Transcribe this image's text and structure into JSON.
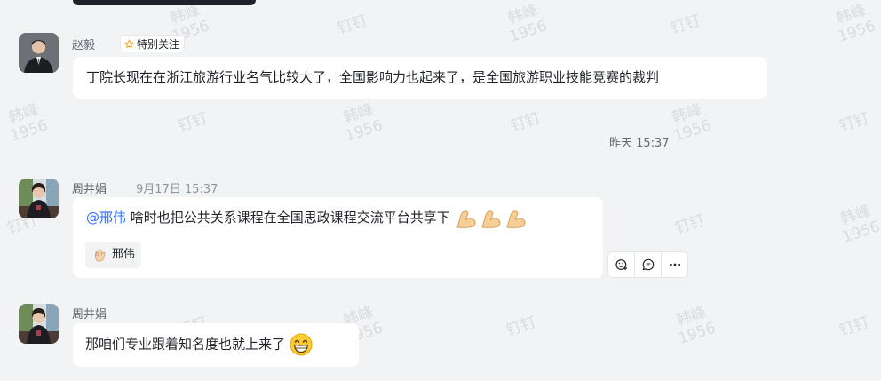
{
  "watermark": {
    "line1": "韩峰",
    "line2": "1956",
    "alt": "钉钉"
  },
  "messages": [
    {
      "sender": "赵毅",
      "tag_label": "特别关注",
      "text": "丁院长现在在浙江旅游行业名气比较大了，全国影响力也起来了，是全国旅游职业技能竞赛的裁判"
    },
    {
      "sender": "周井娟",
      "time": "9月17日 15:37",
      "mention": "@邢伟",
      "text": " 啥时也把公共关系课程在全国思政课程交流平台共享下",
      "reaction_user": "邢伟"
    },
    {
      "sender": "周井娟",
      "text": "那咱们专业跟着知名度也就上来了"
    }
  ],
  "divider_time": "昨天 15:37",
  "colors": {
    "background": "#f2f3f5",
    "bubble": "#ffffff",
    "mention": "#3370ff",
    "tag_star": "#f5a623"
  }
}
